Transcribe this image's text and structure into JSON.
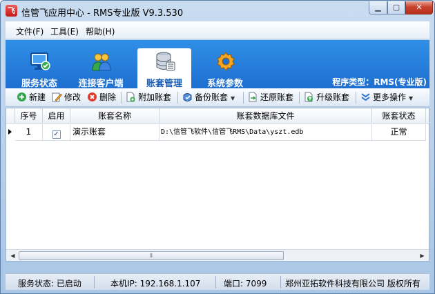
{
  "window": {
    "title": "信管飞应用中心 - RMS专业版 V9.3.530",
    "app_icon_glyph": "飞"
  },
  "menu": [
    "文件(F)",
    "工具(E)",
    "帮助(H)"
  ],
  "tabs": [
    {
      "label": "服务状态",
      "icon": "monitor-icon",
      "active": false
    },
    {
      "label": "连接客户端",
      "icon": "users-icon",
      "active": false
    },
    {
      "label": "账套管理",
      "icon": "database-icon",
      "active": true
    },
    {
      "label": "系统参数",
      "icon": "gear-icon",
      "active": false
    }
  ],
  "program_type": "程序类型：RMS(专业版)",
  "toolbar": {
    "new": "新建",
    "edit": "修改",
    "delete": "删除",
    "attach": "附加账套",
    "backup": "备份账套",
    "restore": "还原账套",
    "upgrade": "升级账套",
    "more": "更多操作"
  },
  "grid": {
    "headers": [
      "序号",
      "启用",
      "账套名称",
      "账套数据库文件",
      "账套状态"
    ],
    "rows": [
      {
        "index": "1",
        "enabled": true,
        "name": "演示账套",
        "file": "D:\\信管飞软件\\信管飞RMS\\Data\\yszt.edb",
        "status": "正常"
      }
    ]
  },
  "status": {
    "service": "服务状态: 已启动",
    "ip": "本机IP: 192.168.1.107",
    "port": "端口: 7099",
    "copyright": "郑州亚拓软件科技有限公司 版权所有"
  },
  "colors": {
    "tab_band": "#1f6fd0",
    "active_tab_text": "#1a5fb8"
  }
}
